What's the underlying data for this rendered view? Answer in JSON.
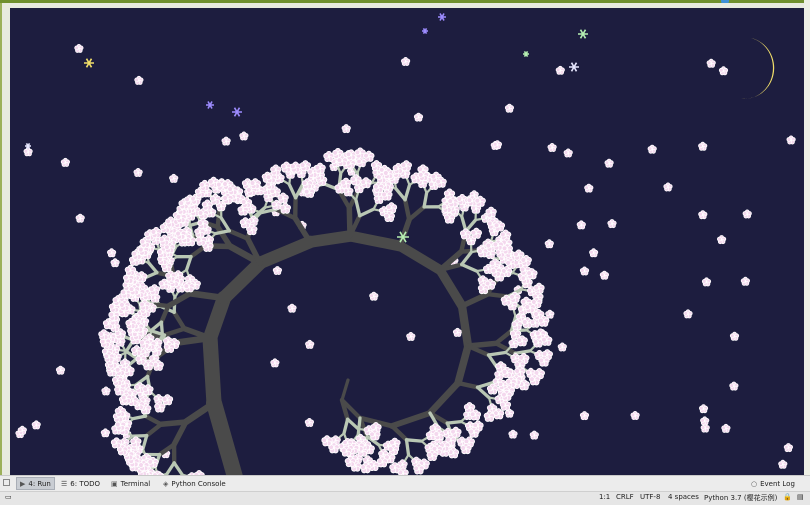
{
  "toolbar": {
    "run_label": "4: Run",
    "todo_label": "6: TODO",
    "terminal_label": "Terminal",
    "python_console_label": "Python Console",
    "event_log_label": "Event Log"
  },
  "statusbar": {
    "position": "1:1",
    "line_separator": "CRLF",
    "encoding": "UTF-8",
    "indent": "4 spaces",
    "interpreter": "Python 3.7 (樱花示例)"
  },
  "colors": {
    "sky": "#1d1d3f",
    "branch": "#4a4a4a",
    "twig": "#b9c7b4",
    "blossom_fill": "#f4d8ee",
    "blossom_edge": "#ffffff",
    "moon": "#f2df6a",
    "star_colors": [
      "#f2df6a",
      "#9d8cff",
      "#b6f0b2",
      "#e7e7ff"
    ]
  },
  "icons": {
    "run": "play-icon",
    "todo": "list-icon",
    "terminal": "terminal-icon",
    "python_console": "python-icon",
    "event_log": "event-log-icon"
  }
}
